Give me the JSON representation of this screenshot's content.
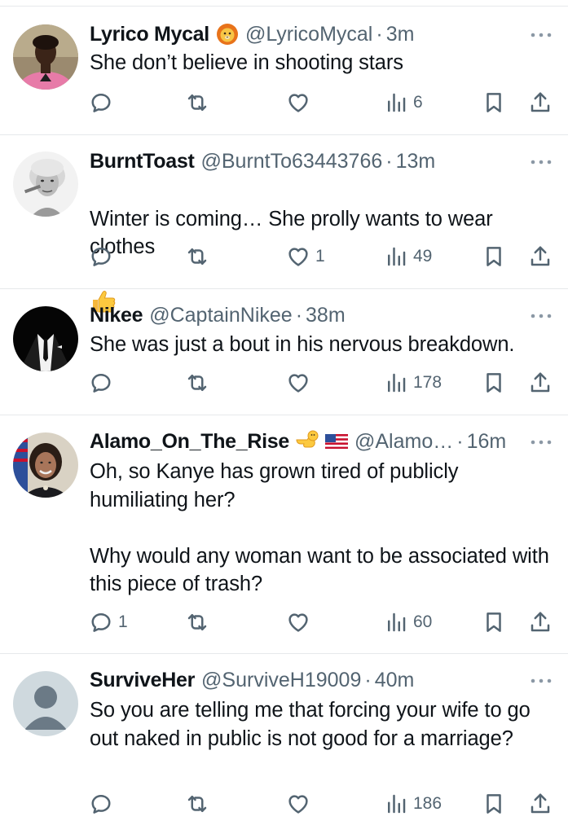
{
  "tweets": [
    {
      "name": "Lyrico Mycal",
      "badge": "lion-emoji",
      "handle": "@LyricoMycal",
      "sep": "·",
      "time": "3m",
      "text": "She don’t believe in shooting stars",
      "emoji": "",
      "counts": {
        "replies": "",
        "retweets": "",
        "likes": "",
        "views": "6"
      }
    },
    {
      "name": "BurntToast",
      "badge": "",
      "handle": "@BurntTo63443766",
      "sep": "·",
      "time": "13m",
      "text": "Winter is coming… She prolly wants to wear clothes",
      "emoji": "thumbs-up-emoji",
      "counts": {
        "replies": "",
        "retweets": "",
        "likes": "1",
        "views": "49"
      }
    },
    {
      "name": "Nikee",
      "badge": "",
      "handle": "@CaptainNikee",
      "sep": "·",
      "time": "38m",
      "text": "She was just a bout in his nervous breakdown.",
      "emoji": "",
      "counts": {
        "replies": "",
        "retweets": "",
        "likes": "",
        "views": "178"
      }
    },
    {
      "name": "Alamo_On_The_Rise",
      "badge": "pointing-emoji us-flag-emoji",
      "handle": "@Alamo…",
      "sep": "·",
      "time": "16m",
      "text": "Oh, so Kanye has grown tired of publicly humiliating her?\n\nWhy would any woman want to be associated with this piece of trash?",
      "emoji": "",
      "counts": {
        "replies": "1",
        "retweets": "",
        "likes": "",
        "views": "60"
      }
    },
    {
      "name": "SurviveHer",
      "badge": "",
      "handle": "@SurviveH19009",
      "sep": "·",
      "time": "40m",
      "text": "So you are telling me that forcing your wife to go out naked in public is not good for a marriage?",
      "emoji": "",
      "counts": {
        "replies": "",
        "retweets": "",
        "likes": "",
        "views": "186"
      }
    }
  ],
  "icons": {
    "reply": "reply-icon",
    "retweet": "retweet-icon",
    "like": "heart-icon",
    "views": "views-icon",
    "bookmark": "bookmark-icon",
    "share": "share-icon",
    "more": "more-icon"
  },
  "colors": {
    "text": "#0f1419",
    "secondary": "#536471",
    "divider": "#e6e9eb"
  }
}
